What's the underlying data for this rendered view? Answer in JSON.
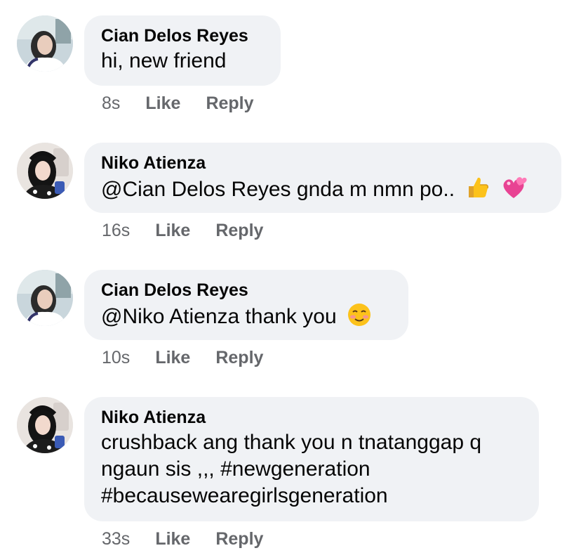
{
  "comments": [
    {
      "author": "Cian Delos Reyes",
      "text": "hi, new friend",
      "time": "8s",
      "like_label": "Like",
      "reply_label": "Reply",
      "avatar": "avatar-cian"
    },
    {
      "author": "Niko Atienza",
      "text": "@Cian Delos Reyes gnda m nmn po..",
      "emojis": [
        "thumbs-up-icon",
        "two-hearts-icon"
      ],
      "time": "16s",
      "like_label": "Like",
      "reply_label": "Reply",
      "avatar": "avatar-niko"
    },
    {
      "author": "Cian Delos Reyes",
      "text": "@Niko Atienza thank you",
      "emojis": [
        "smiling-face-icon"
      ],
      "time": "10s",
      "like_label": "Like",
      "reply_label": "Reply",
      "avatar": "avatar-cian"
    },
    {
      "author": "Niko Atienza",
      "text_lines": [
        "crushback ang thank you n tnatanggap q",
        "ngaun sis ,,, #newgeneration",
        "#becausewearegirlsgeneration"
      ],
      "time": "33s",
      "like_label": "Like",
      "reply_label": "Reply",
      "avatar": "avatar-niko"
    }
  ],
  "colors": {
    "bubble_bg": "#f0f2f5",
    "text": "#050505",
    "meta": "#65676b"
  }
}
